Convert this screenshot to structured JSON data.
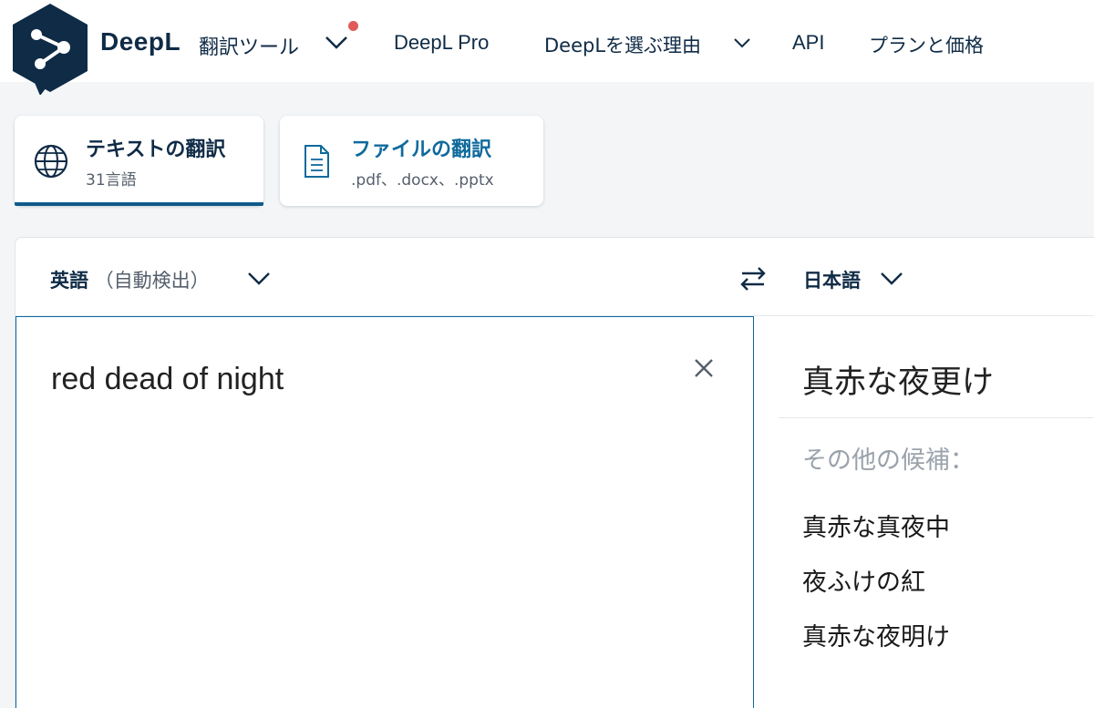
{
  "header": {
    "brand": "DeepL",
    "brand_sub": "翻訳ツール",
    "nav": {
      "pro": "DeepL Pro",
      "why": "DeepLを選ぶ理由",
      "api": "API",
      "pricing": "プランと価格"
    }
  },
  "modes": {
    "text": {
      "title": "テキストの翻訳",
      "sub": "31言語"
    },
    "file": {
      "title": "ファイルの翻訳",
      "sub": ".pdf、.docx、.pptx"
    }
  },
  "translator": {
    "source_lang": "英語",
    "source_detect": "（自動検出）",
    "target_lang": "日本語",
    "source_text": "red dead of night",
    "target_text": "真赤な夜更け",
    "alternatives_label": "その他の候補：",
    "alternatives": [
      "真赤な真夜中",
      "夜ふけの紅",
      "真赤な夜明け"
    ]
  },
  "colors": {
    "brand": "#0f2b46",
    "accent": "#0f6a9c",
    "notification": "#e05a5a"
  },
  "icons": {
    "logo": "deepl-logo-icon",
    "text_mode": "globe-icon",
    "file_mode": "document-icon",
    "swap": "swap-arrows-icon",
    "clear": "close-icon"
  }
}
